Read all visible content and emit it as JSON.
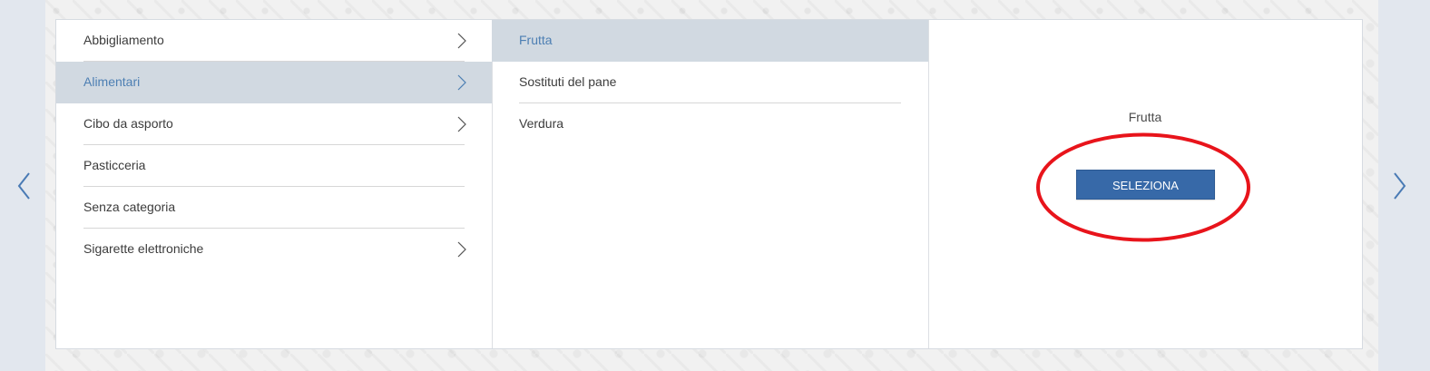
{
  "nav": {
    "prev_icon": "chevron-left-icon",
    "next_icon": "chevron-right-icon",
    "arrow_color": "#4a7bb5"
  },
  "categories": [
    {
      "label": "Abbigliamento",
      "has_children": true,
      "active": false
    },
    {
      "label": "Alimentari",
      "has_children": true,
      "active": true
    },
    {
      "label": "Cibo da asporto",
      "has_children": true,
      "active": false
    },
    {
      "label": "Pasticceria",
      "has_children": false,
      "active": false
    },
    {
      "label": "Senza categoria",
      "has_children": false,
      "active": false
    },
    {
      "label": "Sigarette elettroniche",
      "has_children": true,
      "active": false
    }
  ],
  "subcategories": [
    {
      "label": "Frutta",
      "active": true
    },
    {
      "label": "Sostituti del pane",
      "active": false
    },
    {
      "label": "Verdura",
      "active": false
    }
  ],
  "preview": {
    "title": "Frutta",
    "select_button_label": "SELEZIONA"
  },
  "colors": {
    "active_row_bg": "#d1d9e1",
    "active_text": "#4d7fb3",
    "button_bg": "#3769a8",
    "highlight_ring": "#e8141b"
  }
}
